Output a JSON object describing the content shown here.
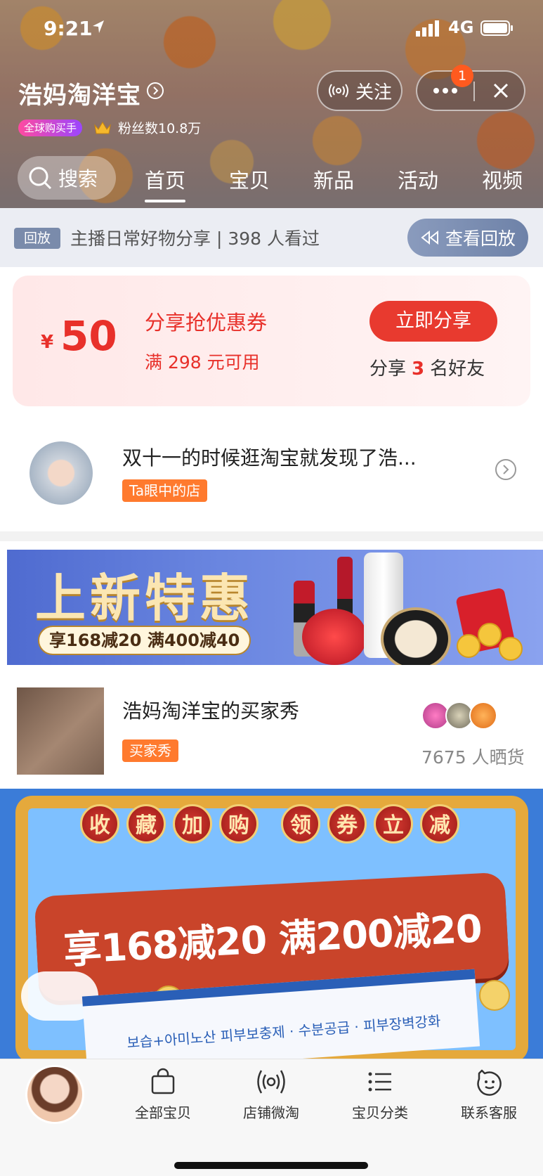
{
  "status_bar": {
    "time": "9:21",
    "network": "4G"
  },
  "header": {
    "shop_name": "浩妈淘洋宝",
    "badge": "全球购买手",
    "fans": "粉丝数10.8万",
    "follow_label": "关注",
    "notification_count": "1",
    "search_label": "搜索",
    "tabs": [
      "首页",
      "宝贝",
      "新品",
      "活动",
      "视频"
    ],
    "active_tab": "首页"
  },
  "replay": {
    "tag": "回放",
    "text": "主播日常好物分享 | 398 人看过",
    "button": "查看回放"
  },
  "coupon": {
    "currency": "¥",
    "amount": "50",
    "title": "分享抢优惠券",
    "condition": "满 298 元可用",
    "button": "立即分享",
    "share_prefix": "分享",
    "share_count": "3",
    "share_suffix": "名好友"
  },
  "story": {
    "title": "双十一的时候逛淘宝就发现了浩...",
    "tag": "Ta眼中的店"
  },
  "banner1": {
    "title": "上新特惠",
    "subtitle": "享168减20 满400减40"
  },
  "buyer_show": {
    "title": "浩妈淘洋宝的买家秀",
    "tag": "买家秀",
    "count_text": "7675 人晒货"
  },
  "banner2": {
    "beads_left": [
      "收",
      "藏",
      "加",
      "购"
    ],
    "beads_right": [
      "领",
      "券",
      "立",
      "减"
    ],
    "ribbon": "享168减20 满200减20",
    "product_line": "보습+아미노산 피부보충제 · 수분공급 · 피부장벽강화"
  },
  "tabbar": {
    "items": [
      "全部宝贝",
      "店铺微淘",
      "宝贝分类",
      "联系客服"
    ]
  },
  "colors": {
    "accent_red": "#e8302a",
    "tag_orange": "#ff7a2e",
    "replay_blue": "#7a8bab"
  }
}
